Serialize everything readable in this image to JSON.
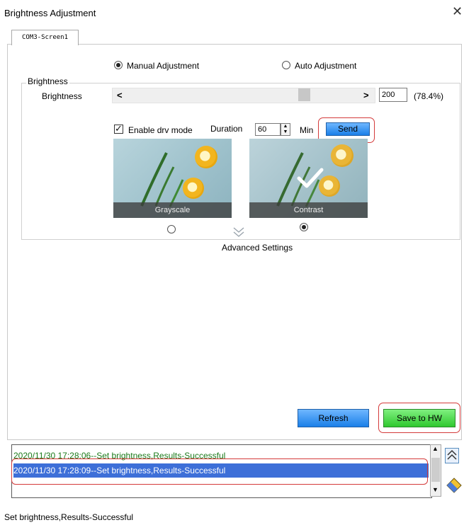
{
  "window": {
    "title": "Brightness Adjustment",
    "close_glyph": "✕"
  },
  "tab": {
    "label": "COM3-Screen1"
  },
  "mode": {
    "manual_label": "Manual Adjustment",
    "auto_label": "Auto Adjustment",
    "selected": "manual"
  },
  "brightness_group": {
    "legend": "Brightness",
    "row_label": "Brightness",
    "slider_left": "<",
    "slider_right": ">",
    "slider_level": 0.784,
    "value": "200",
    "percent": "(78.4%)"
  },
  "drv": {
    "enable_label": "Enable drv mode",
    "enabled": true,
    "duration_label": "Duration",
    "duration_value": "60",
    "unit_label": "Min",
    "send_label": "Send"
  },
  "presets": [
    {
      "caption": "Grayscale",
      "selected": false
    },
    {
      "caption": "Contrast",
      "selected": true
    }
  ],
  "advanced": {
    "label": "Advanced Settings",
    "icon": "double-chevron-down-icon"
  },
  "actions": {
    "refresh_label": "Refresh",
    "save_label": "Save to HW"
  },
  "log": {
    "entries": [
      {
        "text": "2020/11/30 17:28:06--Set brightness,Results-Successful",
        "selected": false,
        "color": "#1a7a1a"
      },
      {
        "text": "2020/11/30 17:28:09--Set brightness,Results-Successful",
        "selected": true,
        "color": "#ffffff"
      }
    ]
  },
  "side_buttons": {
    "collapse_icon": "double-chevron-up-icon",
    "clear_icon": "eraser-icon"
  },
  "status": {
    "text": "Set brightness,Results-Successful"
  },
  "colors": {
    "accent_blue": "#1a7fe8",
    "save_green": "#2fc82f",
    "highlight_red": "#d43a3a",
    "selection": "#3d6fd8"
  }
}
